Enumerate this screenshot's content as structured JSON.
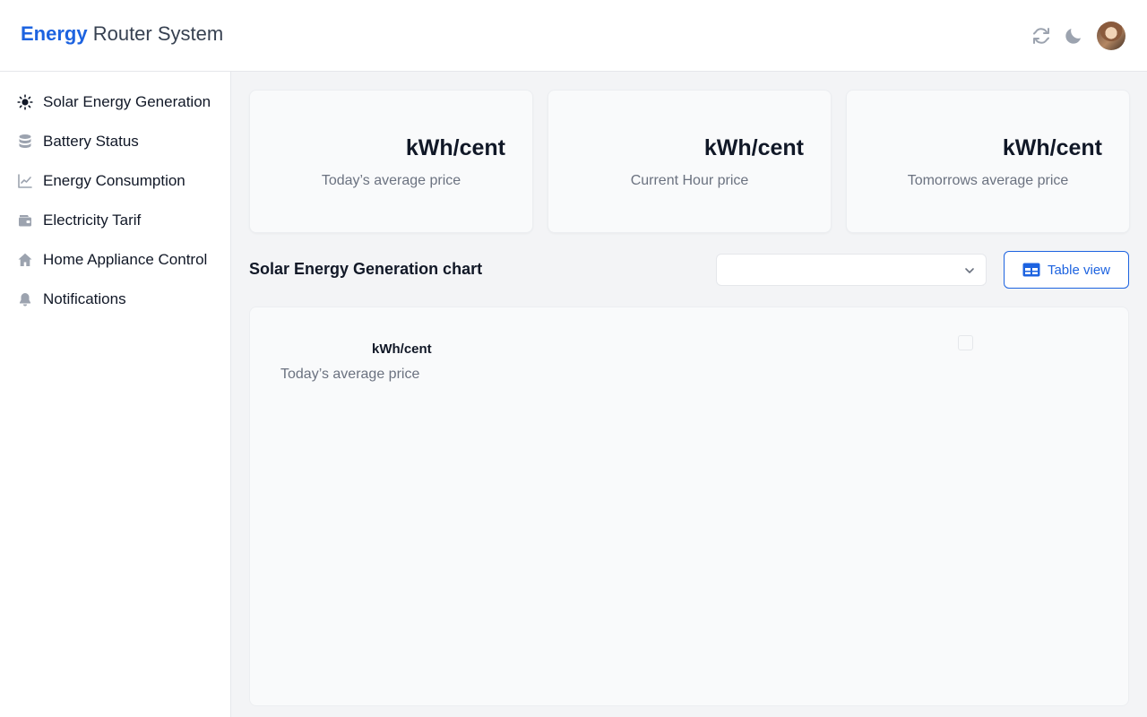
{
  "header": {
    "brand_strong": "Energy",
    "brand_rest": " Router System",
    "icons": [
      "refresh-icon",
      "moon-icon"
    ],
    "avatar": "user-avatar"
  },
  "sidebar": {
    "items": [
      {
        "label": "Solar Energy Generation",
        "icon": "sun-icon"
      },
      {
        "label": "Battery Status",
        "icon": "database-icon"
      },
      {
        "label": "Energy Consumption",
        "icon": "line-chart-icon"
      },
      {
        "label": "Electricity Tarif",
        "icon": "wallet-icon"
      },
      {
        "label": "Home Appliance Control",
        "icon": "home-icon"
      },
      {
        "label": "Notifications",
        "icon": "bell-icon"
      }
    ]
  },
  "cards": [
    {
      "value": "kWh/cent",
      "label": "Today’s average price"
    },
    {
      "value": "kWh/cent",
      "label": "Current Hour price"
    },
    {
      "value": "kWh/cent",
      "label": "Tomorrows average price"
    }
  ],
  "chart_section": {
    "title": "Solar Energy Generation chart",
    "select_value": "",
    "table_view_label": "Table view",
    "panel_value": "kWh/cent",
    "panel_label": "Today’s average price"
  },
  "colors": {
    "accent": "#1d63e0",
    "icon_gray": "#9ca3af",
    "background": "#f3f4f6"
  }
}
